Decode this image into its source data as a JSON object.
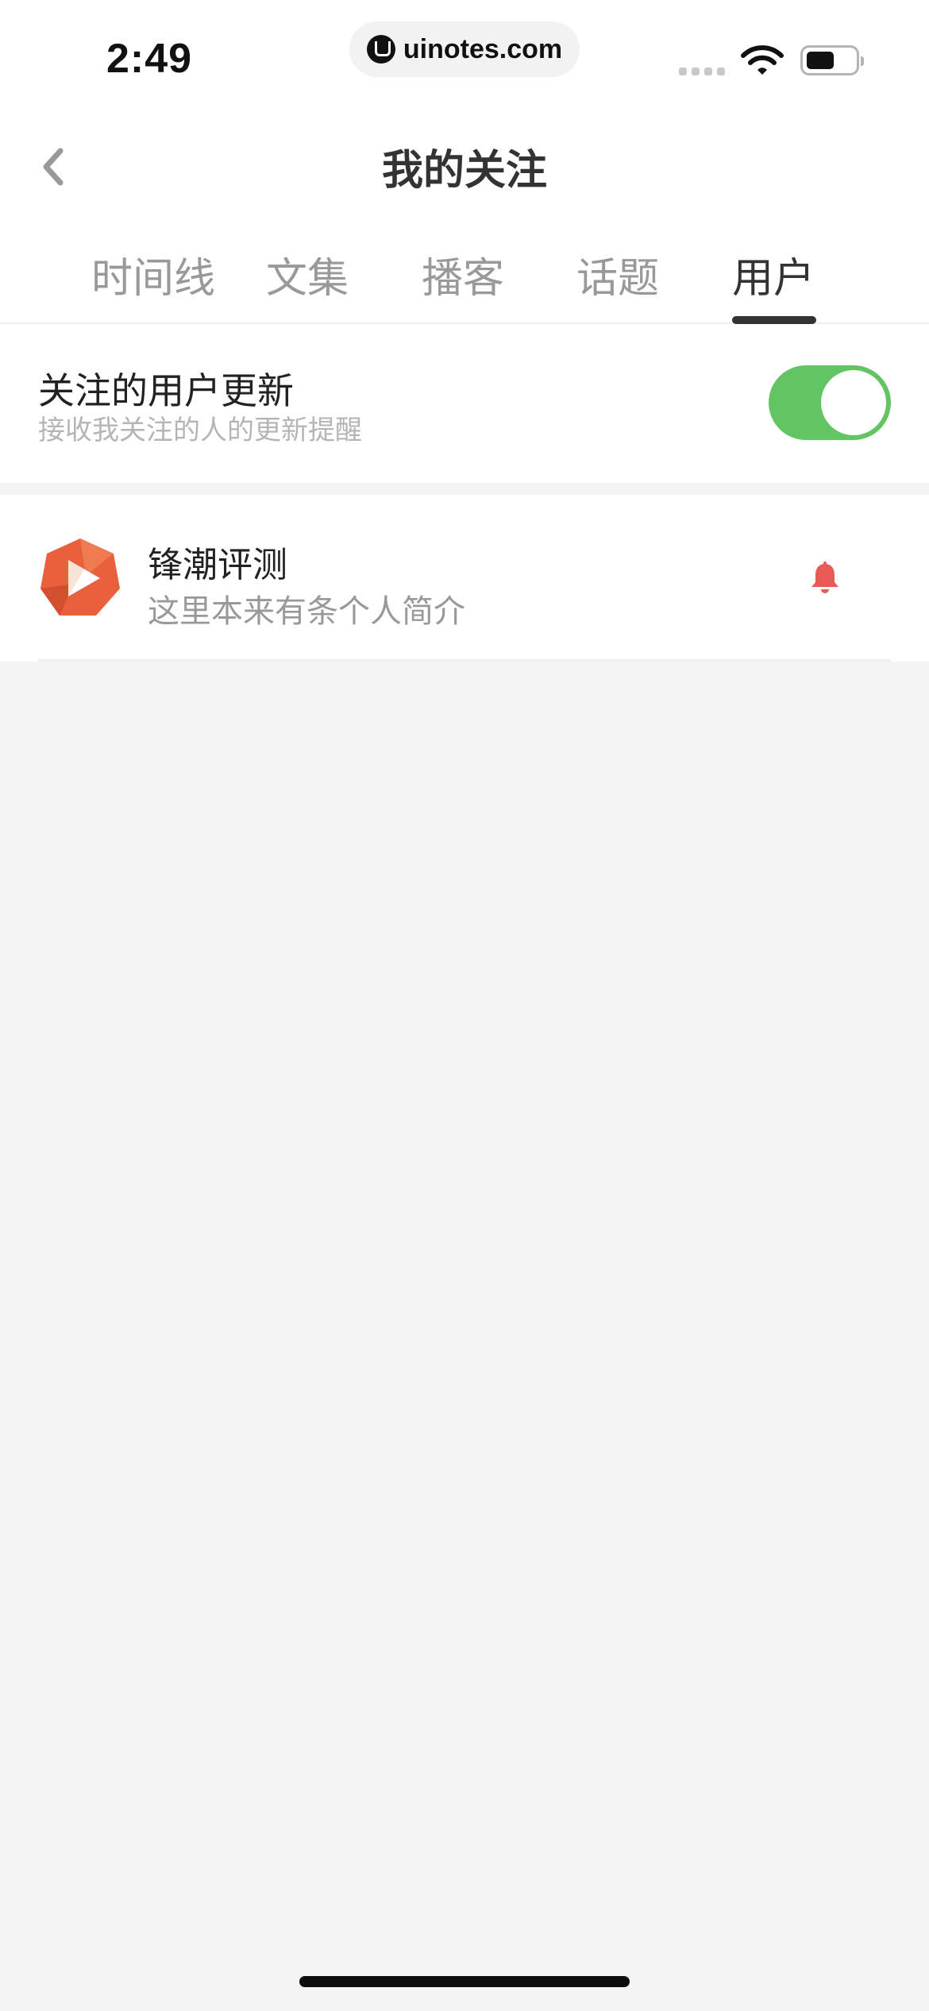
{
  "status_bar": {
    "time": "2:49",
    "url": "uinotes.com"
  },
  "header": {
    "title": "我的关注"
  },
  "tabs": [
    {
      "label": "时间线",
      "active": false
    },
    {
      "label": "文集",
      "active": false
    },
    {
      "label": "播客",
      "active": false
    },
    {
      "label": "话题",
      "active": false
    },
    {
      "label": "用户",
      "active": true
    }
  ],
  "setting": {
    "title": "关注的用户更新",
    "subtitle": "接收我关注的人的更新提醒",
    "enabled": true
  },
  "users": [
    {
      "name": "锋潮评测",
      "bio": "这里本来有条个人简介",
      "notify_icon": "bell-icon"
    }
  ],
  "colors": {
    "toggle_on": "#62c463",
    "bell": "#e85a55",
    "avatar": "#e8603c"
  }
}
